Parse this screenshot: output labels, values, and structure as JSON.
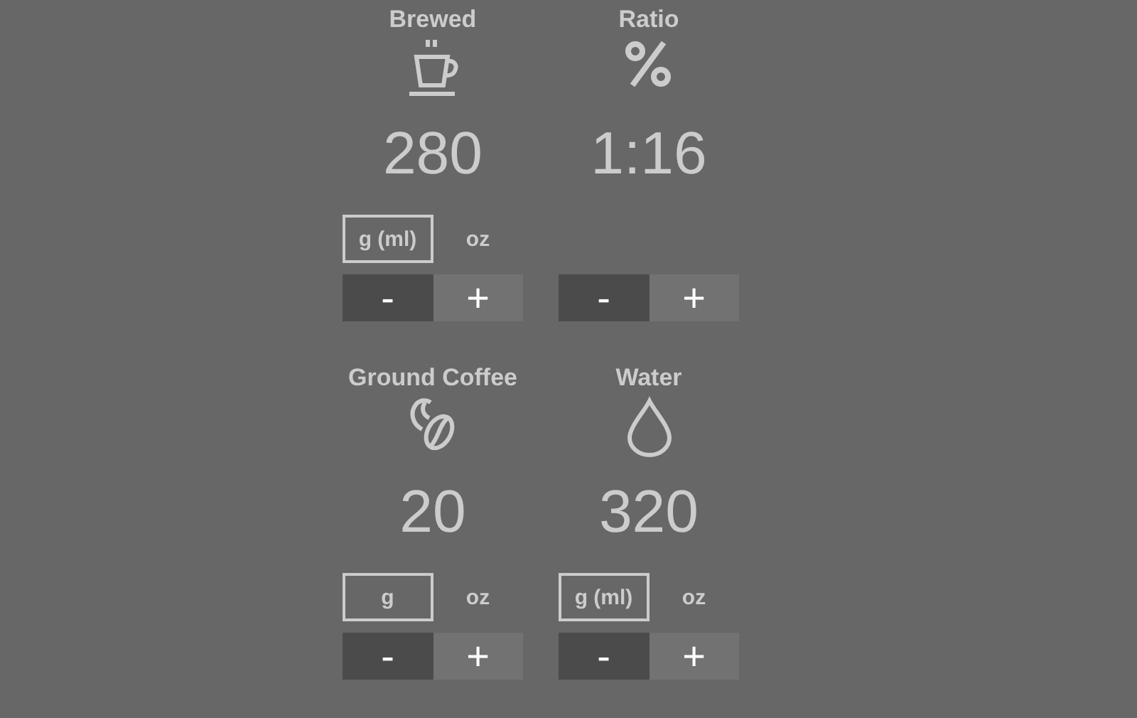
{
  "cards": [
    {
      "title": "Brewed",
      "kind": "cup",
      "value": "280",
      "units": [
        {
          "label": "g (ml)",
          "selected": true
        },
        {
          "label": "oz",
          "selected": false
        }
      ],
      "buttons": [
        "-",
        "+"
      ]
    },
    {
      "title": "Ratio",
      "kind": "percent",
      "value": "1:16",
      "buttons": [
        "-",
        "+"
      ]
    },
    {
      "title": "Ground Coffee",
      "kind": "beans",
      "value": "20",
      "units": [
        {
          "label": "g",
          "selected": true
        },
        {
          "label": "oz",
          "selected": false
        }
      ],
      "buttons": [
        "-",
        "+"
      ]
    },
    {
      "title": "Water",
      "kind": "drop",
      "value": "320",
      "units": [
        {
          "label": "g (ml)",
          "selected": true
        },
        {
          "label": "oz",
          "selected": false
        }
      ],
      "buttons": [
        "-",
        "+"
      ]
    }
  ]
}
